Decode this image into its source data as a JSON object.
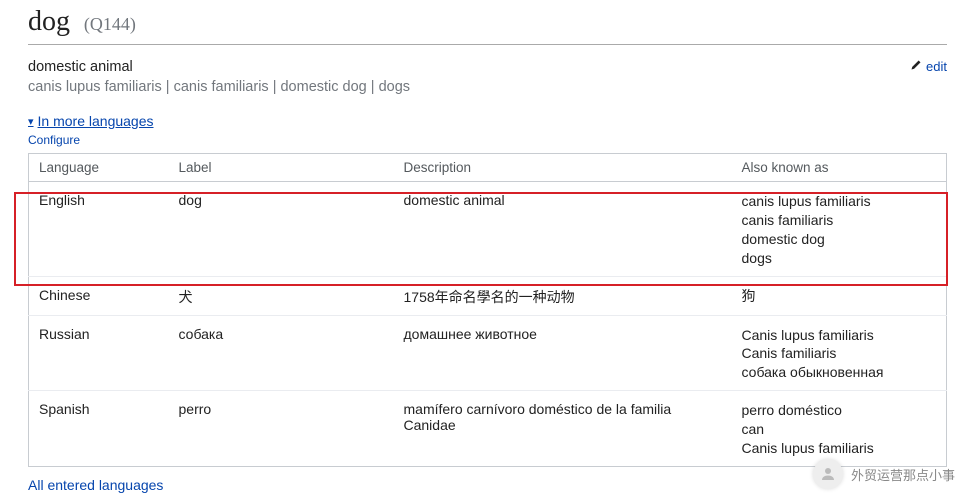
{
  "header": {
    "title": "dog",
    "qid": "(Q144)",
    "description": "domestic animal",
    "aliases_joined": "canis lupus familiaris | canis familiaris | domestic dog | dogs",
    "edit_label": "edit"
  },
  "toggle": {
    "in_more_languages": "In more languages",
    "configure": "Configure"
  },
  "table": {
    "headers": {
      "language": "Language",
      "label": "Label",
      "description": "Description",
      "aka": "Also known as"
    },
    "rows": [
      {
        "language": "English",
        "label": "dog",
        "description": "domestic animal",
        "aka": [
          "canis lupus familiaris",
          "canis familiaris",
          "domestic dog",
          "dogs"
        ]
      },
      {
        "language": "Chinese",
        "label": "犬",
        "description": "1758年命名學名的一种动物",
        "aka": [
          "狗"
        ]
      },
      {
        "language": "Russian",
        "label": "собака",
        "description": "домашнее животное",
        "aka": [
          "Canis lupus familiaris",
          "Canis familiaris",
          "собака обыкновенная"
        ]
      },
      {
        "language": "Spanish",
        "label": "perro",
        "description": "mamífero carnívoro doméstico de la familia Canidae",
        "aka": [
          "perro doméstico",
          "can",
          "Canis lupus familiaris"
        ]
      }
    ]
  },
  "footer": {
    "all_entered_languages": "All entered languages"
  },
  "watermark": {
    "text": "外贸运营那点小事"
  }
}
